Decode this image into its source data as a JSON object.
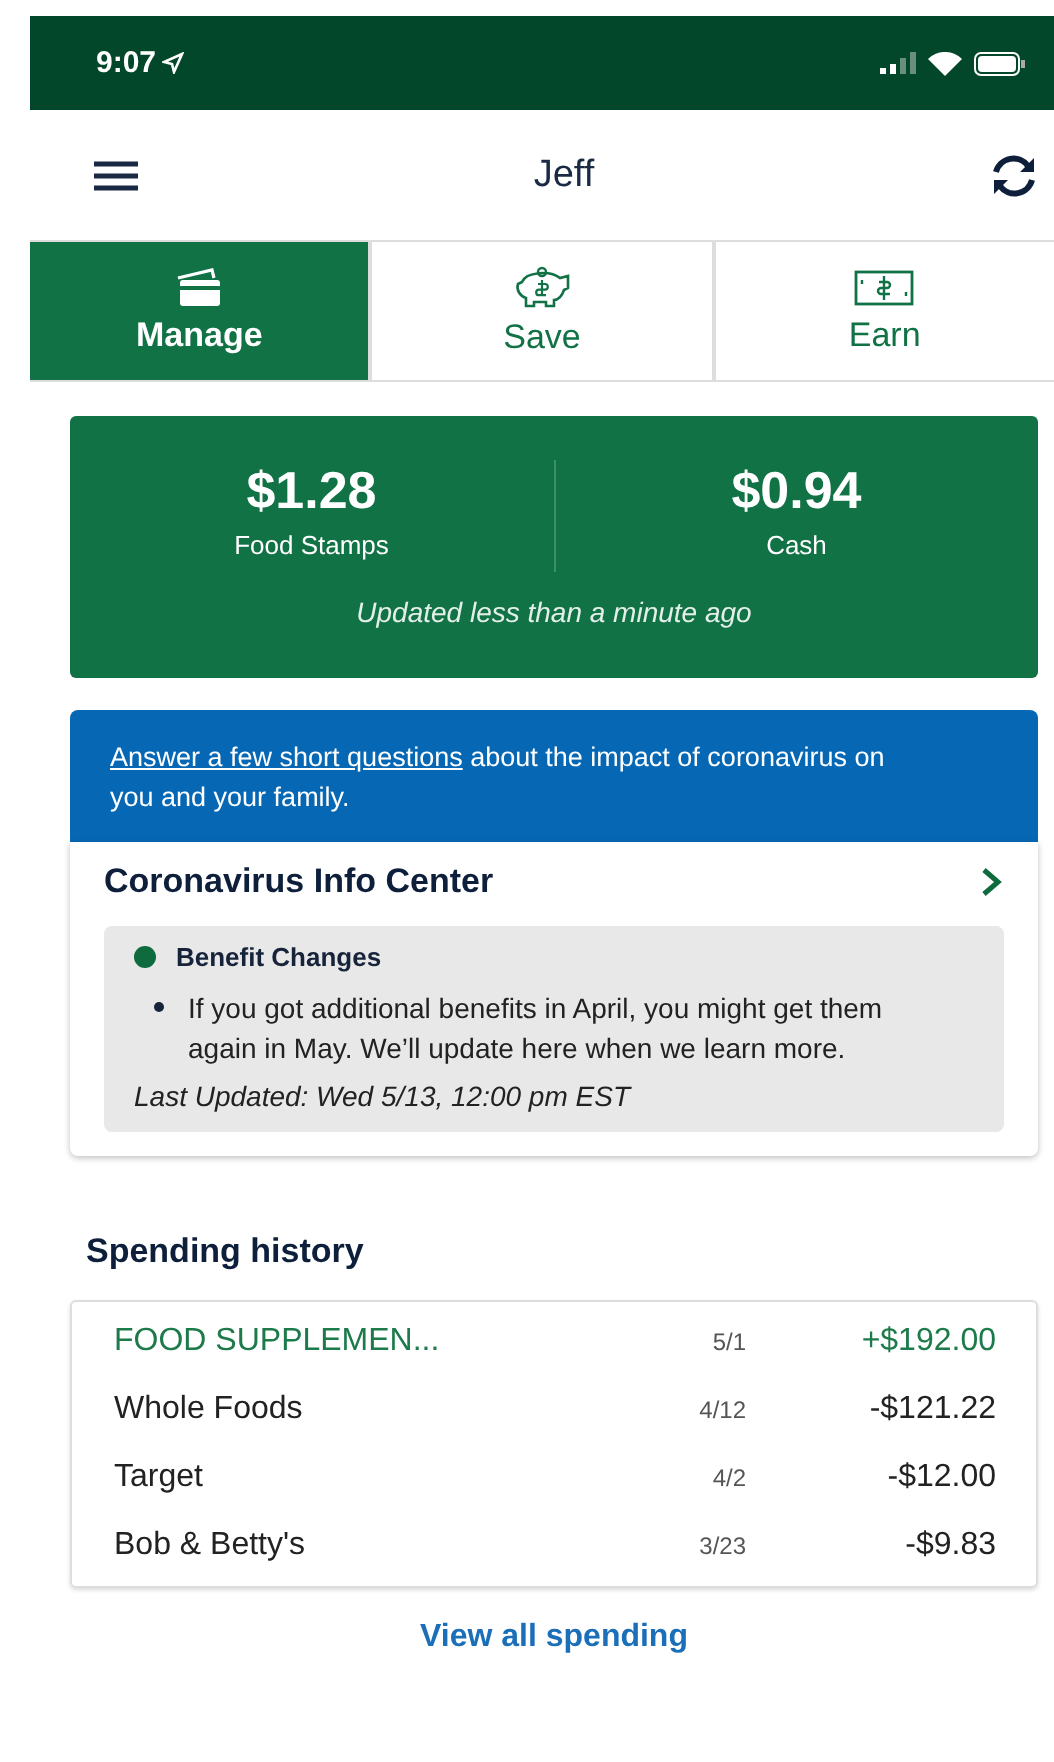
{
  "status_bar": {
    "time": "9:07"
  },
  "header": {
    "title": "Jeff"
  },
  "tabs": [
    {
      "label": "Manage",
      "selected": true,
      "kind": "card"
    },
    {
      "label": "Save",
      "selected": false,
      "kind": "piggy"
    },
    {
      "label": "Earn",
      "selected": false,
      "kind": "cash"
    }
  ],
  "balances": {
    "items": [
      {
        "amount": "$1.28",
        "label": "Food Stamps"
      },
      {
        "amount": "$0.94",
        "label": "Cash"
      }
    ],
    "updated": "Updated less than a minute ago"
  },
  "survey_banner": {
    "link": "Answer a few short questions",
    "text": "about the impact of coronavirus on you and your family."
  },
  "info_center": {
    "title": "Coronavirus Info Center",
    "heading": "Benefit Changes",
    "color": "#0d6b3e",
    "bullets": [
      "If you got additional benefits in April, you might get them again in May. We’ll update here when we learn more."
    ],
    "last_updated": "Last Updated: Wed 5/13, 12:00 pm EST"
  },
  "spending_history": {
    "title": "Spending history",
    "rows": [
      {
        "name": "FOOD SUPPLEMEN...",
        "date": "5/1",
        "amount": "+$192.00",
        "kind": "credit"
      },
      {
        "name": "Whole Foods",
        "date": "4/12",
        "amount": "-$121.22",
        "kind": "debit"
      },
      {
        "name": "Target",
        "date": "4/2",
        "amount": "-$12.00",
        "kind": "debit"
      },
      {
        "name": "Bob & Betty's",
        "date": "3/23",
        "amount": "-$9.83",
        "kind": "debit"
      }
    ],
    "link": "View all spending"
  }
}
